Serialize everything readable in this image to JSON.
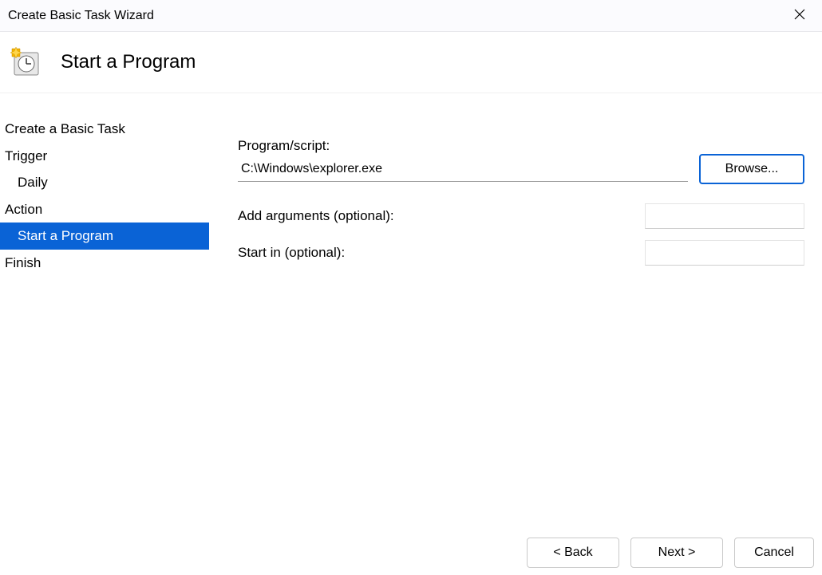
{
  "window": {
    "title": "Create Basic Task Wizard"
  },
  "header": {
    "heading": "Start a Program"
  },
  "sidebar": {
    "steps": {
      "create": "Create a Basic Task",
      "trigger": "Trigger",
      "trigger_sub": "Daily",
      "action": "Action",
      "action_sub": "Start a Program",
      "finish": "Finish"
    }
  },
  "form": {
    "program_label": "Program/script:",
    "program_value": "C:\\Windows\\explorer.exe",
    "browse_label": "Browse...",
    "args_label": "Add arguments (optional):",
    "args_value": "",
    "startin_label": "Start in (optional):",
    "startin_value": ""
  },
  "footer": {
    "back": "< Back",
    "next": "Next >",
    "cancel": "Cancel"
  }
}
